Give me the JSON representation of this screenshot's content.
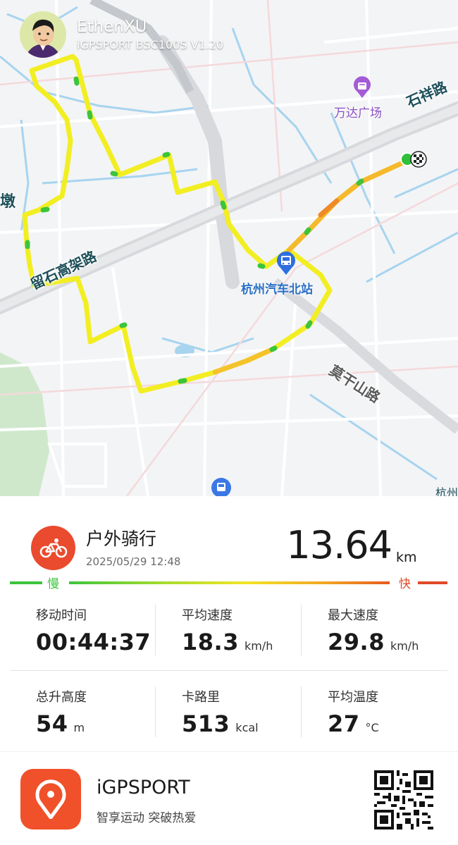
{
  "header": {
    "username": "EthenXU",
    "device": "iGPSPORT BSC100S  V1.20"
  },
  "map": {
    "labels": {
      "shixiang_road": "石祥路",
      "wanda_plaza": "万达广场",
      "east_edge": "墩",
      "elevated_road": "留石高架路",
      "bus_station": "杭州汽车北站",
      "moganshan_road": "莫干山路",
      "bottom_right": "杭州"
    },
    "icons": [
      "wanda-plaza-pin-icon",
      "bus-station-pin-icon",
      "bus-stop-icon",
      "start-dot-icon",
      "finish-flag-icon"
    ]
  },
  "activity": {
    "type": "户外骑行",
    "datetime": "2025/05/29 12:48",
    "distance": "13.64",
    "distance_unit": "km",
    "icon": "cycling-icon",
    "accent_color": "#ea4a2e"
  },
  "speed_legend": {
    "slow": "慢",
    "fast": "快"
  },
  "stats": {
    "moving_time": {
      "label": "移动时间",
      "value": "00:44:37",
      "unit": ""
    },
    "avg_speed": {
      "label": "平均速度",
      "value": "18.3",
      "unit": "km/h"
    },
    "max_speed": {
      "label": "最大速度",
      "value": "29.8",
      "unit": "km/h"
    },
    "elevation_gain": {
      "label": "总升高度",
      "value": "54",
      "unit": "m"
    },
    "calories": {
      "label": "卡路里",
      "value": "513",
      "unit": "kcal"
    },
    "avg_temp": {
      "label": "平均温度",
      "value": "27",
      "unit": "°C"
    }
  },
  "footer": {
    "brand": "iGPSPORT",
    "slogan": "智享运动 突破热爱",
    "logo_color": "#f0512a"
  }
}
